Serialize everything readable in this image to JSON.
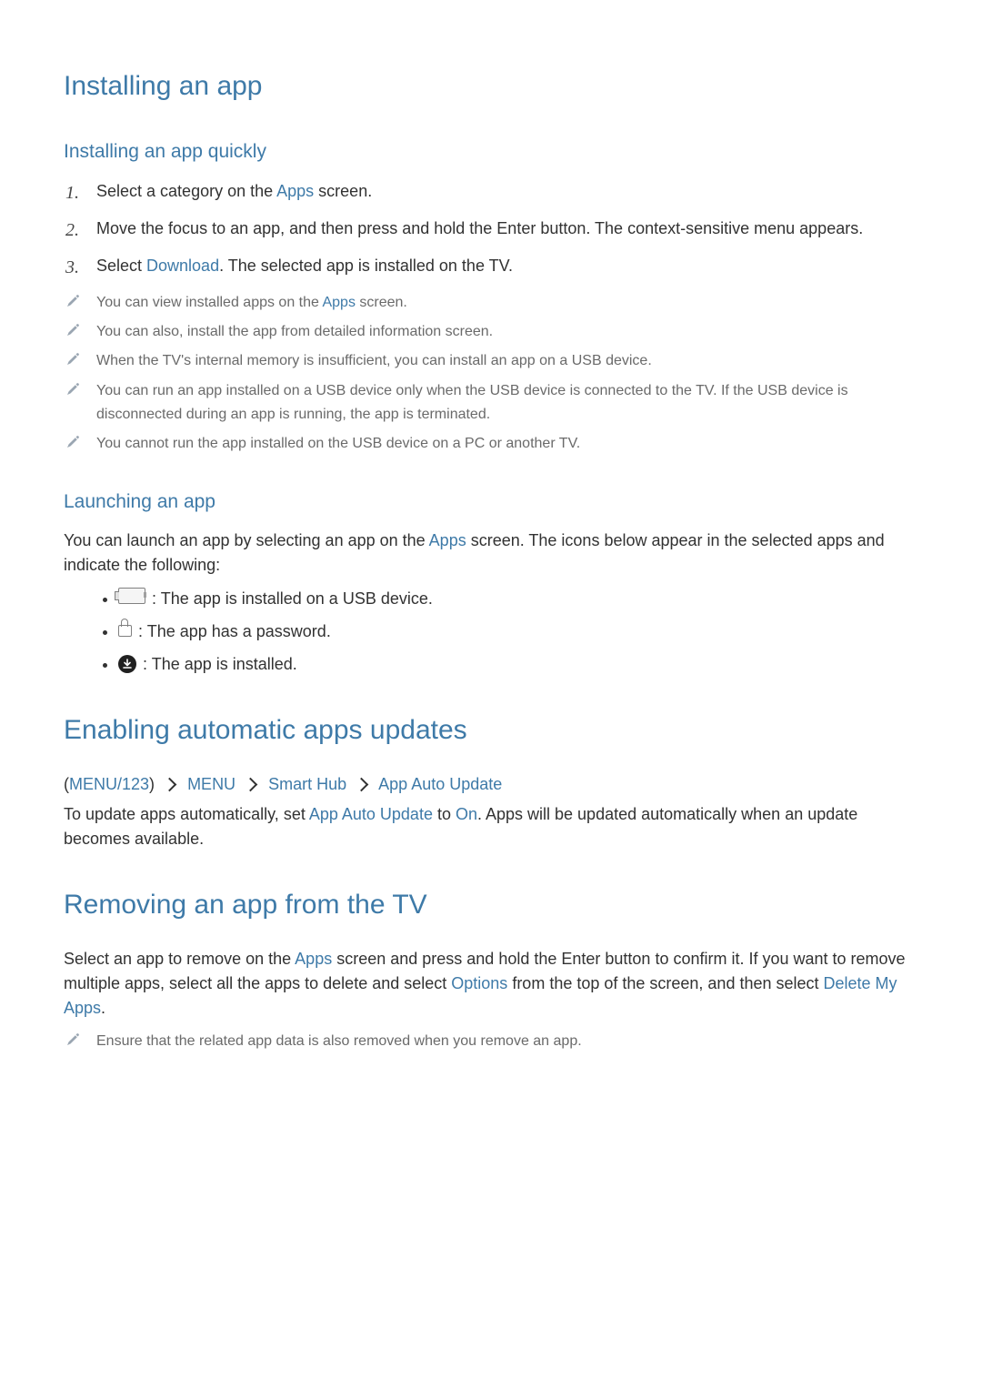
{
  "heading1_installing": "Installing an app",
  "heading2_quickly": "Installing an app quickly",
  "steps": [
    {
      "num": "1.",
      "pre": "Select a category on the ",
      "link": "Apps",
      "post": " screen."
    },
    {
      "num": "2.",
      "pre": "Move the focus to an app, and then press and hold the Enter button. The context-sensitive menu appears.",
      "link": "",
      "post": ""
    },
    {
      "num": "3.",
      "pre": "Select ",
      "link": "Download",
      "post": ". The selected app is installed on the TV."
    }
  ],
  "notes1": [
    {
      "pre": "You can view installed apps on the ",
      "link": "Apps",
      "post": " screen."
    },
    {
      "pre": "You can also, install the app from detailed information screen.",
      "link": "",
      "post": ""
    },
    {
      "pre": "When the TV's internal memory is insufficient, you can install an app on a USB device.",
      "link": "",
      "post": ""
    },
    {
      "pre": "You can run an app installed on a USB device only when the USB device is connected to the TV. If the USB device is disconnected during an app is running, the app is terminated.",
      "link": "",
      "post": ""
    },
    {
      "pre": "You cannot run the app installed on the USB device on a PC or another TV.",
      "link": "",
      "post": ""
    }
  ],
  "heading2_launching": "Launching an app",
  "launching_body_pre": "You can launch an app by selecting an app on the ",
  "launching_body_link": "Apps",
  "launching_body_post": " screen. The icons below appear in the selected apps and indicate the following:",
  "icon_items": [
    ": The app is installed on a USB device.",
    ": The app has a password.",
    ": The app is installed."
  ],
  "heading1_enabling": "Enabling automatic apps updates",
  "path": {
    "a": "MENU/123",
    "b": "MENU",
    "c": "Smart Hub",
    "d": "App Auto Update"
  },
  "enabling_body_pre": "To update apps automatically, set ",
  "enabling_body_link1": "App Auto Update",
  "enabling_body_mid": " to ",
  "enabling_body_link2": "On",
  "enabling_body_post": ". Apps will be updated automatically when an update becomes available.",
  "heading1_removing": "Removing an app from the TV",
  "removing_body_pre": "Select an app to remove on the ",
  "removing_body_link1": "Apps",
  "removing_body_mid1": " screen and press and hold the Enter button to confirm it. If you want to remove multiple apps, select all the apps to delete and select ",
  "removing_body_link2": "Options",
  "removing_body_mid2": " from the top of the screen, and then select ",
  "removing_body_link3": "Delete My Apps",
  "removing_body_post": ".",
  "notes2": [
    {
      "pre": "Ensure that the related app data is also removed when you remove an app.",
      "link": "",
      "post": ""
    }
  ]
}
